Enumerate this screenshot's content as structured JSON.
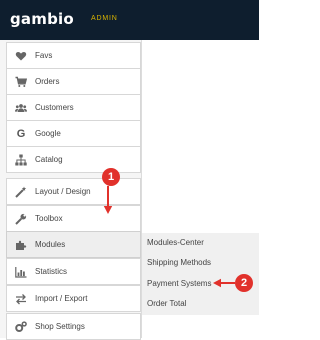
{
  "header": {
    "brand": "gambio",
    "badge": "ADMIN"
  },
  "sidebar": {
    "items": [
      {
        "label": "Favs",
        "icon": "heart-icon"
      },
      {
        "label": "Orders",
        "icon": "cart-icon"
      },
      {
        "label": "Customers",
        "icon": "users-icon"
      },
      {
        "label": "Google",
        "icon": "google-icon"
      },
      {
        "label": "Catalog",
        "icon": "sitemap-icon"
      },
      {
        "label": "Layout / Design",
        "icon": "magic-wand-icon"
      },
      {
        "label": "Toolbox",
        "icon": "wrench-icon"
      },
      {
        "label": "Modules",
        "icon": "puzzle-icon"
      },
      {
        "label": "Statistics",
        "icon": "chart-icon"
      },
      {
        "label": "Import / Export",
        "icon": "exchange-icon"
      },
      {
        "label": "Shop Settings",
        "icon": "gears-icon"
      }
    ]
  },
  "submenu": {
    "items": [
      "Modules-Center",
      "Shipping Methods",
      "Payment Systems",
      "Order Total"
    ]
  },
  "annotations": {
    "marker_1": "1",
    "marker_2": "2",
    "color": "#e1312b"
  }
}
